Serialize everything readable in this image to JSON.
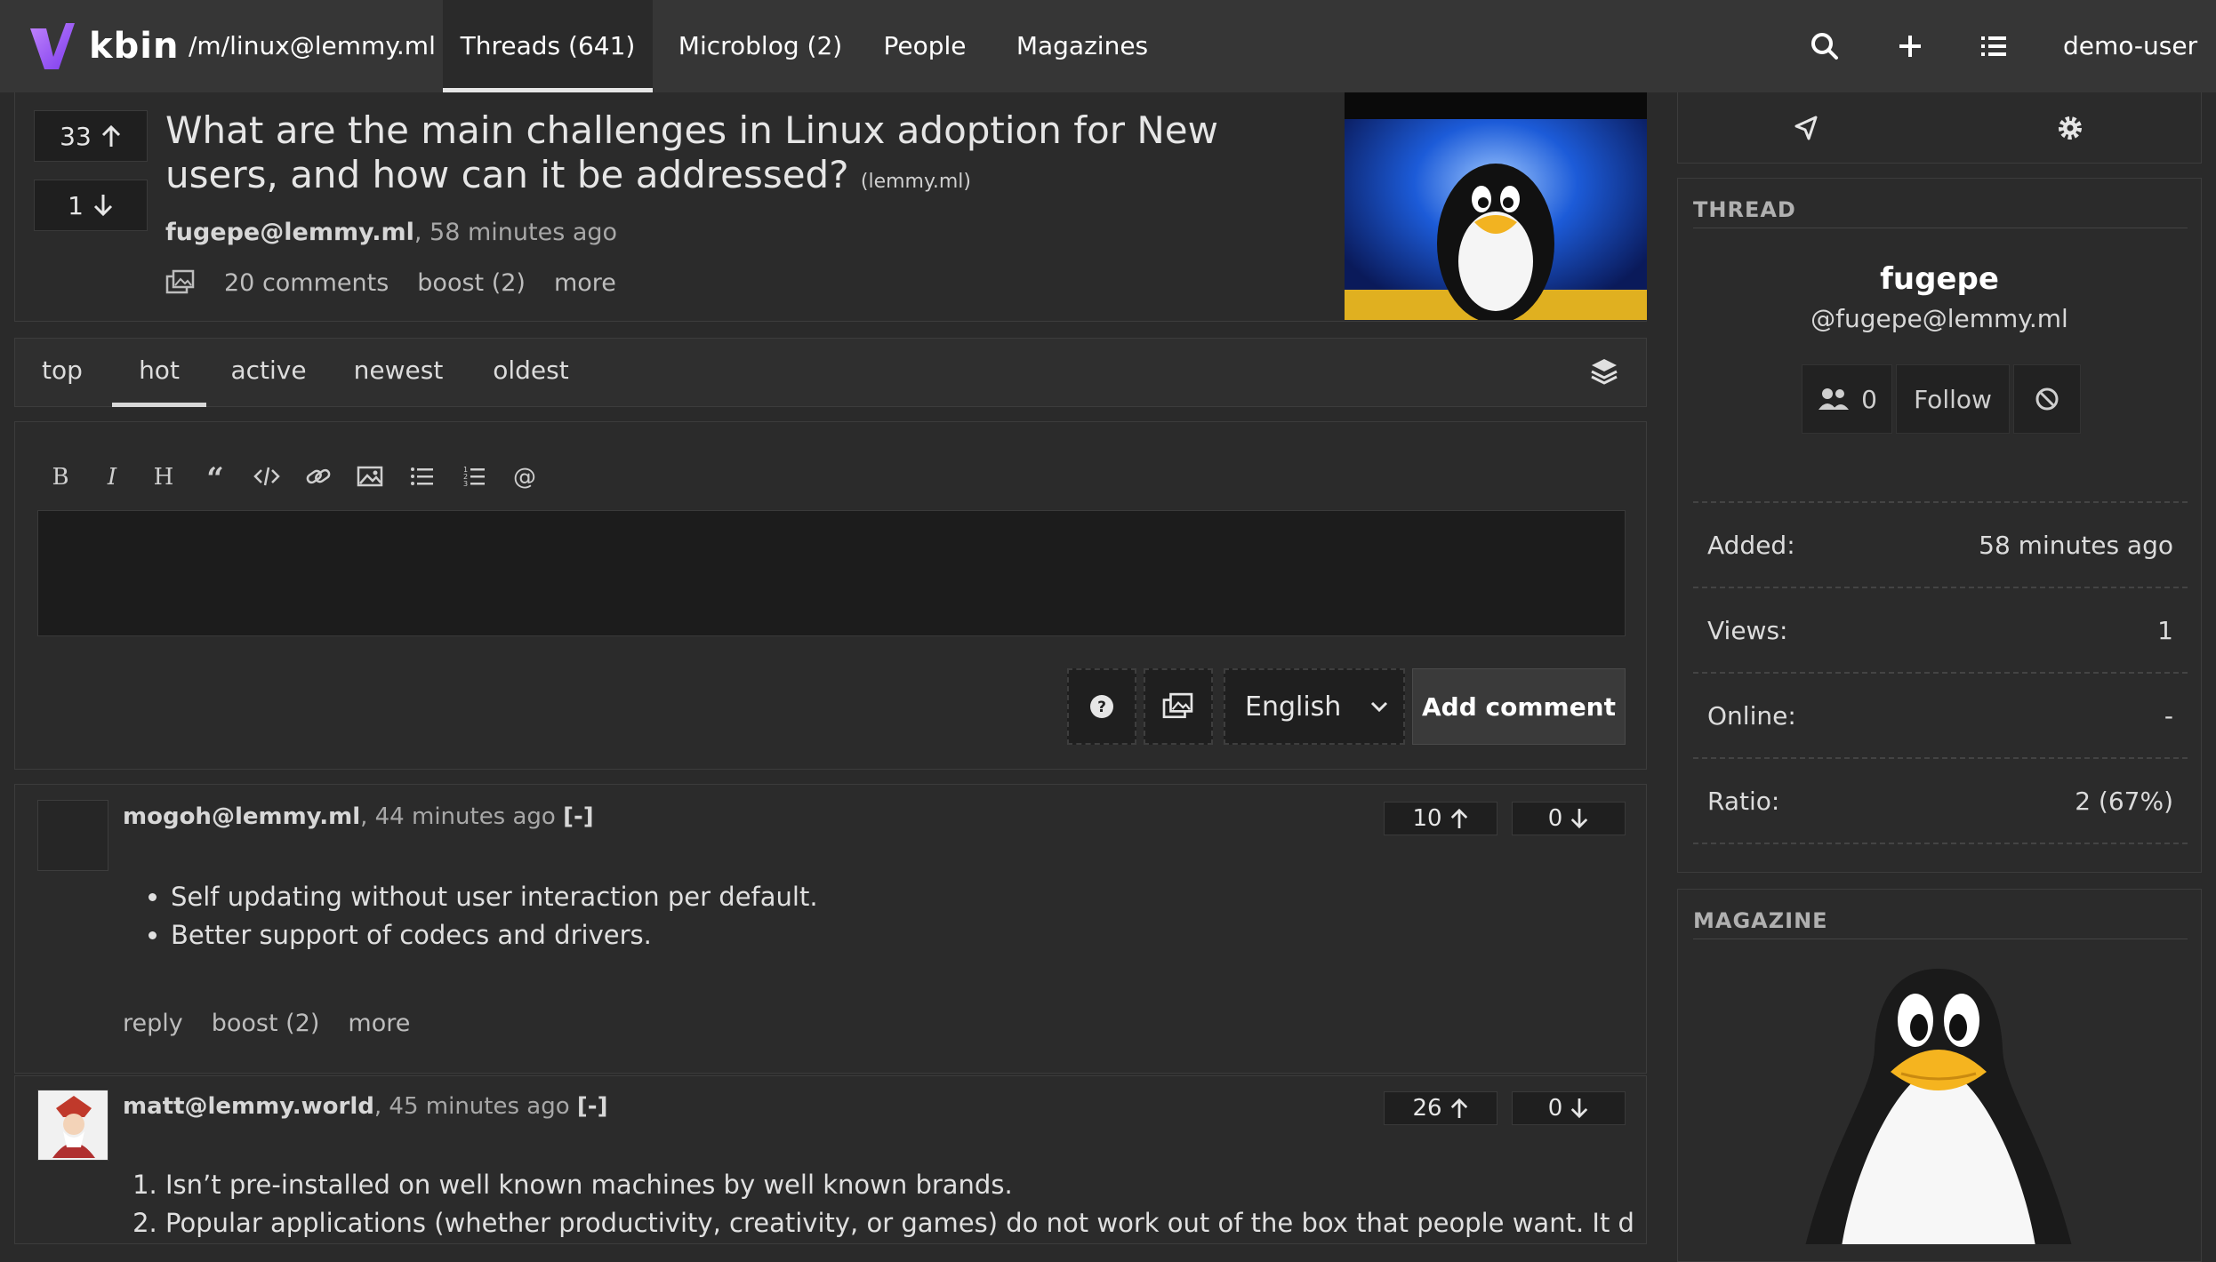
{
  "app": {
    "name": "kbin",
    "accent": "#a855f7"
  },
  "nav": {
    "magazine_link": "/m/linux@lemmy.ml",
    "tabs": [
      "Threads (641)",
      "Microblog (2)",
      "People",
      "Magazines"
    ],
    "user": "demo-user",
    "icons": [
      "search-icon",
      "plus-icon",
      "list-icon"
    ]
  },
  "entry": {
    "upvotes": "33",
    "downvotes": "1",
    "title": "What are the main challenges in Linux adoption for New users, and how can it be addressed?",
    "domain": "(lemmy.ml)",
    "author": "fugepe@lemmy.ml",
    "time": ", 58 minutes ago",
    "comments": "20 comments",
    "boost": "boost (2)",
    "more": "more"
  },
  "sort_options": [
    "top",
    "hot",
    "active",
    "newest",
    "oldest"
  ],
  "active_sort": "hot",
  "comment_form": {
    "language": "English",
    "submit": "Add comment"
  },
  "comments": [
    {
      "author": "mogoh@lemmy.ml",
      "time": ", 44 minutes ago",
      "collapse": "[-]",
      "upvotes": "10",
      "downvotes": "0",
      "items": [
        "Self updating without user interaction per default.",
        "Better support of codecs and drivers."
      ],
      "reply": "reply",
      "boost": "boost (2)",
      "more": "more"
    },
    {
      "author": "matt@lemmy.world",
      "time": ", 45 minutes ago",
      "collapse": "[-]",
      "upvotes": "26",
      "downvotes": "0",
      "items": [
        "Isn’t pre-installed on well known machines by well known brands.",
        "Popular applications (whether productivity, creativity, or games) do not work out of the box that people want. It doesn’t"
      ]
    }
  ],
  "sidebar": {
    "thread_heading": "THREAD",
    "author_name": "fugepe",
    "author_handle": "@fugepe@lemmy.ml",
    "followers": "0",
    "follow": "Follow",
    "stats": [
      {
        "label": "Added:",
        "value": "58 minutes ago"
      },
      {
        "label": "Views:",
        "value": "1"
      },
      {
        "label": "Online:",
        "value": "-"
      },
      {
        "label": "Ratio:",
        "value": "2 (67%)"
      }
    ],
    "magazine_heading": "MAGAZINE"
  }
}
